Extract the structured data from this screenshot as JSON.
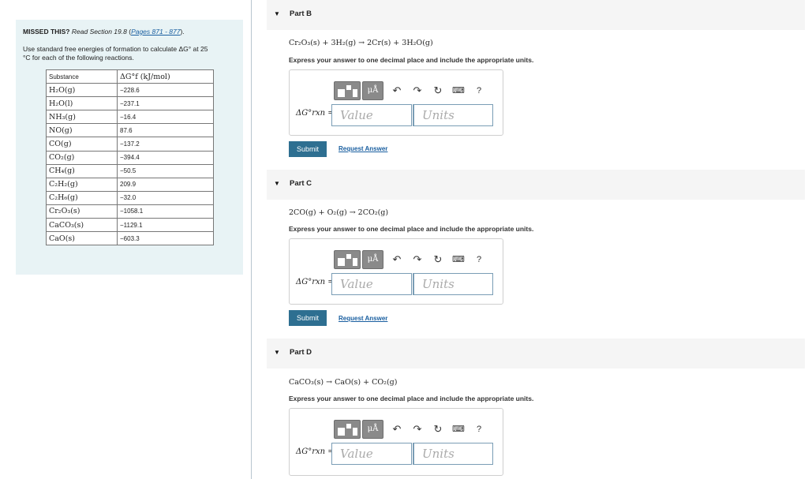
{
  "sidebar": {
    "missed_label": "MISSED THIS?",
    "read_text": "Read Section 19.8",
    "pages_link": "Pages 871 - 877",
    "instruction_line1": "Use standard free energies of formation to calculate ΔG° at 25",
    "instruction_line2": "°C for each of the following reactions.",
    "table": {
      "headers": [
        "Substance",
        "ΔG°f (kJ/mol)"
      ],
      "rows": [
        [
          "H₂O(g)",
          "−228.6"
        ],
        [
          "H₂O(l)",
          "−237.1"
        ],
        [
          "NH₃(g)",
          "−16.4"
        ],
        [
          "NO(g)",
          "87.6"
        ],
        [
          "CO(g)",
          "−137.2"
        ],
        [
          "CO₂(g)",
          "−394.4"
        ],
        [
          "CH₄(g)",
          "−50.5"
        ],
        [
          "C₂H₂(g)",
          "209.9"
        ],
        [
          "C₂H₆(g)",
          "−32.0"
        ],
        [
          "Cr₂O₃(s)",
          "−1058.1"
        ],
        [
          "CaCO₃(s)",
          "−1129.1"
        ],
        [
          "CaO(s)",
          "−603.3"
        ]
      ]
    }
  },
  "parts": [
    {
      "title": "Part B",
      "equation": "Cr₂O₃(s) + 3H₂(g) → 2Cr(s) + 3H₂O(g)",
      "instruction": "Express your answer to one decimal place and include the appropriate units.",
      "label": "ΔG°rxn =",
      "value_placeholder": "Value",
      "units_placeholder": "Units",
      "submit_label": "Submit",
      "request_label": "Request Answer"
    },
    {
      "title": "Part C",
      "equation": "2CO(g) + O₂(g) → 2CO₂(g)",
      "instruction": "Express your answer to one decimal place and include the appropriate units.",
      "label": "ΔG°rxn =",
      "value_placeholder": "Value",
      "units_placeholder": "Units",
      "submit_label": "Submit",
      "request_label": "Request Answer"
    },
    {
      "title": "Part D",
      "equation": "CaCO₃(s) → CaO(s) + CO₂(g)",
      "instruction": "Express your answer to one decimal place and include the appropriate units.",
      "label": "ΔG°rxn =",
      "value_placeholder": "Value",
      "units_placeholder": "Units"
    }
  ],
  "toolbar": {
    "mu_label": "μÅ",
    "undo_glyph": "↶",
    "redo_glyph": "↷",
    "reset_glyph": "↻",
    "keyboard_glyph": "⌨",
    "help_glyph": "?"
  },
  "icons": {
    "caret": "▼"
  },
  "colors": {
    "sidebar_bg": "#e8f3f5",
    "submit_bg": "#2e6f91",
    "link": "#1a5fa0",
    "toolbar_btn": "#8a8a8a"
  }
}
